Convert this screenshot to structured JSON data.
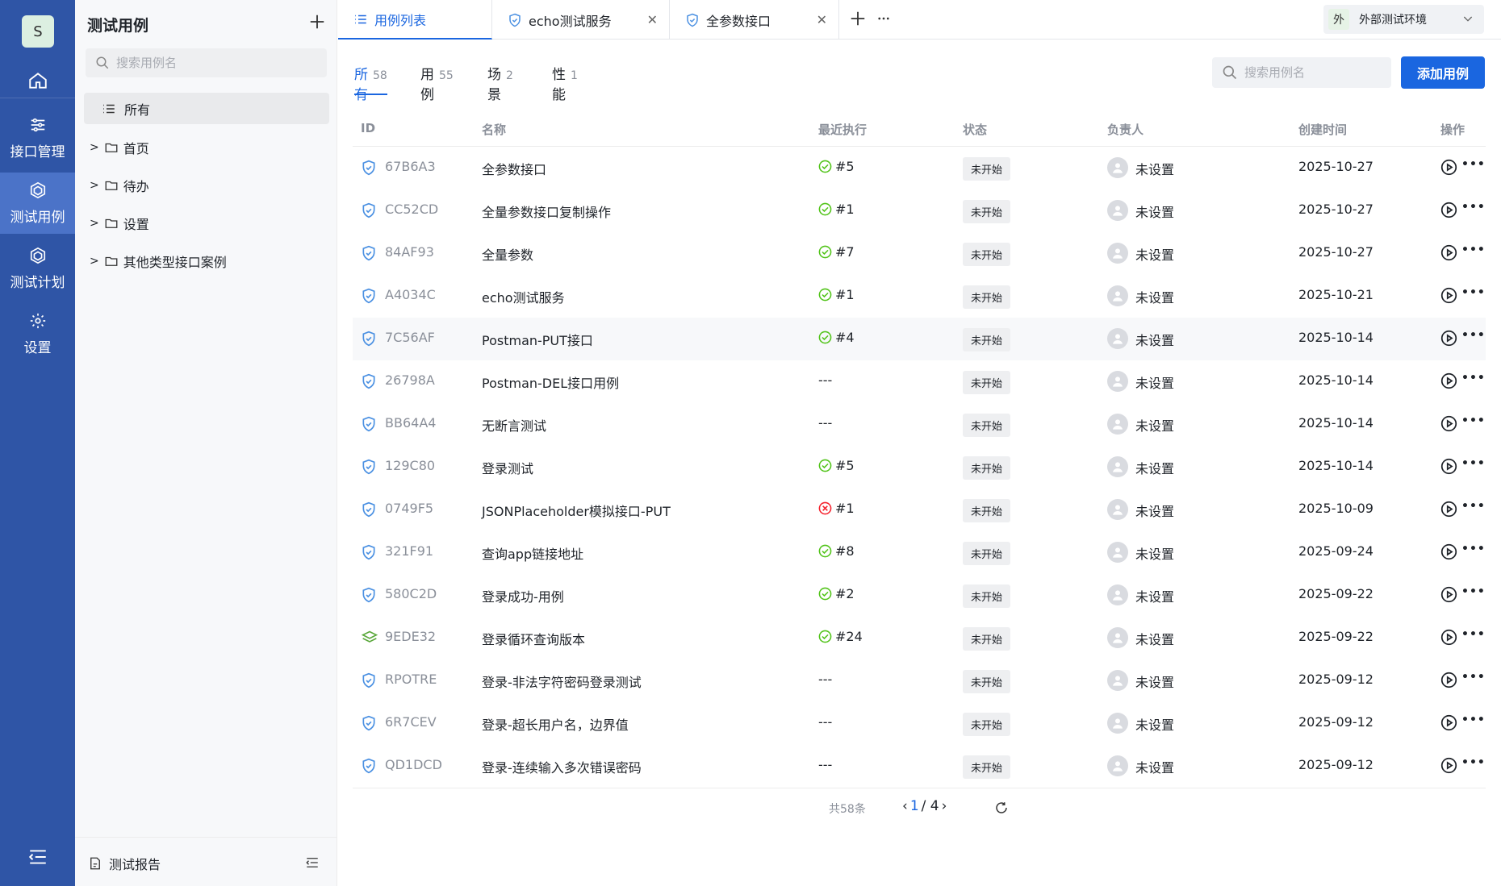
{
  "rail": {
    "avatar_letter": "S",
    "items": [
      {
        "label": "接口管理",
        "icon": "sliders-icon"
      },
      {
        "label": "测试用例",
        "icon": "cube-icon",
        "active": true
      },
      {
        "label": "测试计划",
        "icon": "cube-icon"
      },
      {
        "label": "设置",
        "icon": "gear-icon"
      }
    ]
  },
  "tree": {
    "title": "测试用例",
    "search_placeholder": "搜索用例名",
    "all_label": "所有",
    "folders": [
      "首页",
      "待办",
      "设置",
      "其他类型接口案例"
    ],
    "report_label": "测试报告"
  },
  "tabs": [
    {
      "label": "用例列表",
      "icon": "list-icon",
      "active": true
    },
    {
      "label": "echo测试服务",
      "icon": "shield-icon"
    },
    {
      "label": "全参数接口",
      "icon": "shield-icon"
    }
  ],
  "env": {
    "tag": "外",
    "name": "外部测试环境"
  },
  "filters": [
    {
      "label": "所有",
      "count": "58",
      "active": true
    },
    {
      "label": "用例",
      "count": "55"
    },
    {
      "label": "场景",
      "count": "2"
    },
    {
      "label": "性能",
      "count": "1"
    }
  ],
  "search_placeholder": "搜索用例名",
  "add_button": "添加用例",
  "columns": {
    "id": "ID",
    "name": "名称",
    "exec": "最近执行",
    "status": "状态",
    "owner": "负责人",
    "created": "创建时间",
    "ops": "操作"
  },
  "rows": [
    {
      "id": "67B6A3",
      "name": "全参数接口",
      "exec": "#5",
      "result": "pass",
      "kind": "shield",
      "status": "未开始",
      "owner": "未设置",
      "date": "2025-10-27"
    },
    {
      "id": "CC52CD",
      "name": "全量参数接口复制操作",
      "exec": "#1",
      "result": "pass",
      "kind": "shield",
      "status": "未开始",
      "owner": "未设置",
      "date": "2025-10-27"
    },
    {
      "id": "84AF93",
      "name": "全量参数",
      "exec": "#7",
      "result": "pass",
      "kind": "shield",
      "status": "未开始",
      "owner": "未设置",
      "date": "2025-10-27"
    },
    {
      "id": "A4034C",
      "name": "echo测试服务",
      "exec": "#1",
      "result": "pass",
      "kind": "shield",
      "status": "未开始",
      "owner": "未设置",
      "date": "2025-10-21"
    },
    {
      "id": "7C56AF",
      "name": "Postman-PUT接口",
      "exec": "#4",
      "result": "pass",
      "kind": "shield",
      "status": "未开始",
      "owner": "未设置",
      "date": "2025-10-14",
      "hover": true
    },
    {
      "id": "26798A",
      "name": "Postman-DEL接口用例",
      "exec": "---",
      "result": "none",
      "kind": "shield",
      "status": "未开始",
      "owner": "未设置",
      "date": "2025-10-14"
    },
    {
      "id": "BB64A4",
      "name": "无断言测试",
      "exec": "---",
      "result": "none",
      "kind": "shield",
      "status": "未开始",
      "owner": "未设置",
      "date": "2025-10-14"
    },
    {
      "id": "129C80",
      "name": "登录测试",
      "exec": "#5",
      "result": "pass",
      "kind": "shield",
      "status": "未开始",
      "owner": "未设置",
      "date": "2025-10-14"
    },
    {
      "id": "0749F5",
      "name": "JSONPlaceholder模拟接口-PUT",
      "exec": "#1",
      "result": "fail",
      "kind": "shield",
      "status": "未开始",
      "owner": "未设置",
      "date": "2025-10-09"
    },
    {
      "id": "321F91",
      "name": "查询app链接地址",
      "exec": "#8",
      "result": "pass",
      "kind": "shield",
      "status": "未开始",
      "owner": "未设置",
      "date": "2025-09-24"
    },
    {
      "id": "580C2D",
      "name": "登录成功-用例",
      "exec": "#2",
      "result": "pass",
      "kind": "shield",
      "status": "未开始",
      "owner": "未设置",
      "date": "2025-09-22"
    },
    {
      "id": "9EDE32",
      "name": "登录循环查询版本",
      "exec": "#24",
      "result": "pass",
      "kind": "layers",
      "status": "未开始",
      "owner": "未设置",
      "date": "2025-09-22"
    },
    {
      "id": "RPOTRE",
      "name": "登录-非法字符密码登录测试",
      "exec": "---",
      "result": "none",
      "kind": "shield",
      "status": "未开始",
      "owner": "未设置",
      "date": "2025-09-12"
    },
    {
      "id": "6R7CEV",
      "name": "登录-超长用户名，边界值",
      "exec": "---",
      "result": "none",
      "kind": "shield",
      "status": "未开始",
      "owner": "未设置",
      "date": "2025-09-12"
    },
    {
      "id": "QD1DCD",
      "name": "登录-连续输入多次错误密码",
      "exec": "---",
      "result": "none",
      "kind": "shield",
      "status": "未开始",
      "owner": "未设置",
      "date": "2025-09-12"
    }
  ],
  "pager": {
    "total": "共58条",
    "current": "1",
    "pages": "/ 4"
  },
  "colors": {
    "rail": "#2f55a6",
    "accent": "#1a66e0",
    "pass": "#52c41a",
    "fail": "#f5222d",
    "shield": "#4a90e2",
    "layers": "#5aa83b"
  }
}
